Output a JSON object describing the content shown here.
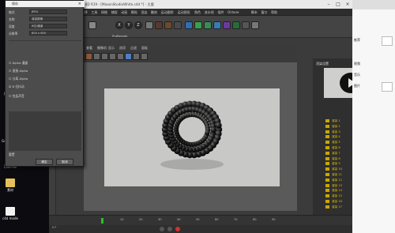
{
  "desktop": {
    "icons": [
      {
        "label": "此电脑"
      },
      {
        "label": "网络"
      },
      {
        "label": "回收站"
      },
      {
        "label": "控制面板"
      },
      {
        "label": "Firefox"
      },
      {
        "label": "Google Chrome"
      },
      {
        "label": "百度网盘"
      },
      {
        "label": "素材"
      },
      {
        "label": "c4d mode"
      }
    ]
  },
  "c4d": {
    "title": "CINEMA 4D R19 - [MaxonStudioWhite.c4d *] - 主要",
    "menu": [
      "文件",
      "编辑",
      "创建",
      "选择",
      "工具",
      "网格",
      "捕捉",
      "动画",
      "模拟",
      "渲染",
      "雕刻",
      "运动跟踪",
      "运动图形",
      "角色",
      "流水线",
      "插件",
      "Octane",
      "脚本",
      "窗口",
      "帮助"
    ],
    "toolbar_label": "ProRender",
    "viewport_menu": [
      "查看",
      "摄像机",
      "显示",
      "选项",
      "过滤",
      "面板"
    ],
    "right_panel_title": "渲染设置",
    "render_rows": [
      {
        "name": "渲染 1",
        "pct": "100%",
        "time": "00:00:08"
      },
      {
        "name": "渲染 2",
        "pct": "100%",
        "time": "00:00:08"
      },
      {
        "name": "渲染 3",
        "pct": "100%",
        "time": "00:00:07"
      },
      {
        "name": "渲染 4",
        "pct": "100%",
        "time": "00:00:07"
      },
      {
        "name": "渲染 5",
        "pct": "100%",
        "time": "00:00:08"
      },
      {
        "name": "渲染 6",
        "pct": "100%",
        "time": "00:00:08"
      },
      {
        "name": "渲染 7",
        "pct": "100%",
        "time": "00:00:07"
      },
      {
        "name": "渲染 8",
        "pct": "100%",
        "time": "00:00:07"
      },
      {
        "name": "渲染 9",
        "pct": "100%",
        "time": "00:00:08"
      },
      {
        "name": "渲染 10",
        "pct": "100%",
        "time": "00:00:08"
      },
      {
        "name": "渲染 11",
        "pct": "100%",
        "time": "00:00:07"
      },
      {
        "name": "渲染 12",
        "pct": "100%",
        "time": "00:00:08"
      },
      {
        "name": "渲染 13",
        "pct": "100%",
        "time": "00:00:07"
      },
      {
        "name": "渲染 14",
        "pct": "100%",
        "time": "00:00:08"
      },
      {
        "name": "渲染 15",
        "pct": "100%",
        "time": "00:00:08"
      },
      {
        "name": "渲染 16",
        "pct": "100%",
        "time": "00:00:07"
      },
      {
        "name": "渲染 17",
        "pct": "100%",
        "time": "00:00:08"
      }
    ],
    "timeline_ticks": [
      "0",
      "10",
      "20",
      "30",
      "40",
      "50",
      "60",
      "70",
      "80",
      "90"
    ],
    "frame_current": "0 F"
  },
  "dialog": {
    "title": "保存",
    "fields": [
      {
        "label": "格式",
        "value": "JPEG"
      },
      {
        "label": "名称",
        "value": "渲染图像"
      },
      {
        "label": "深度",
        "value": "8位/通道"
      },
      {
        "label": "分辨率",
        "value": "800 x 600"
      }
    ],
    "options": [
      "Alpha 通道",
      "直接 Alpha",
      "分离 Alpha",
      "8 位抖动",
      "包括声音"
    ],
    "ok": "确定",
    "cancel": "取消",
    "reset": "重置"
  },
  "browser": {
    "items": [
      "推荐",
      "视频",
      "音乐",
      "图片"
    ]
  },
  "colors": {
    "accent_green": "#4cd04c",
    "accent_yellow": "#f0c000",
    "c4d_blue": "#2f6fb0"
  }
}
